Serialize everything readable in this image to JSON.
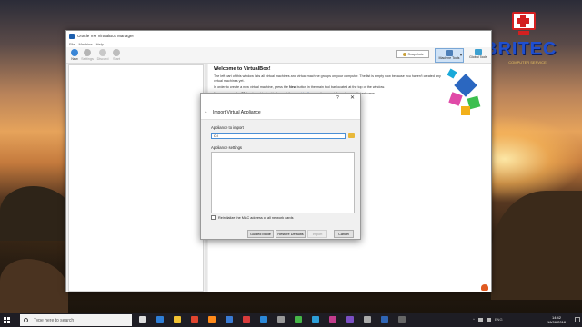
{
  "logo": {
    "text": "BRITEC",
    "tagline": "COMPUTER SERVICE"
  },
  "window": {
    "title": "Oracle VM VirtualBox Manager"
  },
  "menu": [
    "File",
    "Machine",
    "Help"
  ],
  "toolbar": {
    "new_label": "New",
    "settings_label": "Settings",
    "discard_label": "Discard",
    "start_label": "Start",
    "snapshots_label": "Snapshots",
    "machine_tools_label": "Machine Tools",
    "global_tools_label": "Global Tools"
  },
  "welcome": {
    "title": "Welcome to VirtualBox!",
    "p1": "The left part of this window lists all virtual machines and virtual machine groups on your computer. The list is empty now because you haven't created any virtual machines yet.",
    "p2_before": "In order to create a new virtual machine, press the ",
    "p2_bold": "New",
    "p2_after": " button in the main tool bar located at the top of the window.",
    "p3_before": "You can press the ",
    "p3_bold": "F1",
    "p3_mid": " key to get instant help, or visit ",
    "p3_link": "www.virtualbox.org",
    "p3_after": " for more information and latest news."
  },
  "dialog": {
    "help_label": "?",
    "close_label": "✕",
    "back_label": "←",
    "title": "Import Virtual Appliance",
    "appliance_label": "Appliance to import",
    "file_value": "C:\\",
    "settings_label": "Appliance settings",
    "reinit_mac_label": "Reinitialize the MAC address of all network cards",
    "reinit_mac_checked": false,
    "guided_mode_label": "Guided Mode",
    "restore_defaults_label": "Restore Defaults",
    "import_label": "Import",
    "cancel_label": "Cancel"
  },
  "taskbar": {
    "search_placeholder": "Type here to search",
    "language": "ENG",
    "time": "14:42",
    "date": "16/06/2018",
    "apps": [
      {
        "name": "task-view-icon",
        "color": "#dddddd"
      },
      {
        "name": "edge-icon",
        "color": "#2f7fd8"
      },
      {
        "name": "file-explorer-icon",
        "color": "#f1c232"
      },
      {
        "name": "chrome-icon",
        "color": "#e0452f"
      },
      {
        "name": "firefox-icon",
        "color": "#ff8a1a"
      },
      {
        "name": "mail-icon",
        "color": "#3a7bd5"
      },
      {
        "name": "media-icon",
        "color": "#d83b3b"
      },
      {
        "name": "store-icon",
        "color": "#2b88d8"
      },
      {
        "name": "settings-icon",
        "color": "#999999"
      },
      {
        "name": "camtasia-icon",
        "color": "#46b648"
      },
      {
        "name": "photoshop-icon",
        "color": "#2d9fd9"
      },
      {
        "name": "app-icon-magenta",
        "color": "#c23c8c"
      },
      {
        "name": "visualstudio-icon",
        "color": "#7b4fc4"
      },
      {
        "name": "app-icon-gray",
        "color": "#aaaaaa"
      },
      {
        "name": "virtualbox-icon",
        "color": "#2f65b5"
      },
      {
        "name": "app-icon-dark",
        "color": "#666666"
      }
    ]
  }
}
